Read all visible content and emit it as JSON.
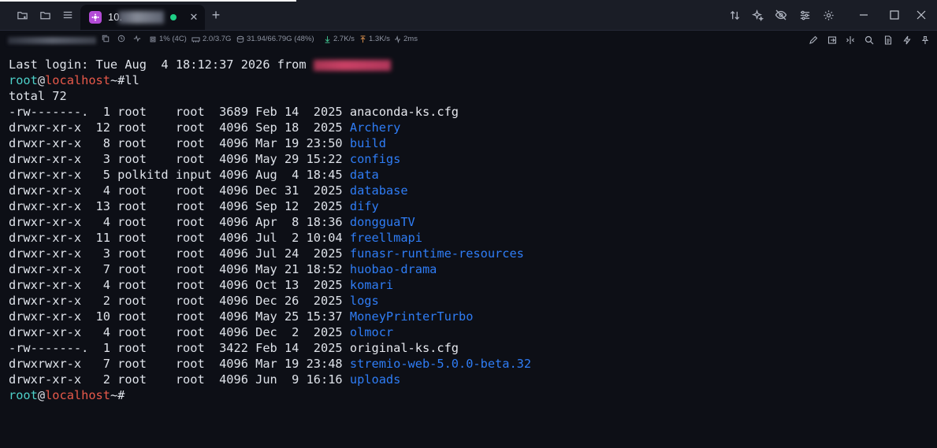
{
  "titlebar": {
    "left_icons": [
      "new-folder-icon",
      "folder-icon",
      "menu-icon"
    ],
    "tab": {
      "title": "10.",
      "icon": "server-icon",
      "status_color": "#1fcf86",
      "close_glyph": "✕"
    },
    "add_tab_glyph": "+",
    "right_icons": [
      "sort-icon",
      "sparkle-icon",
      "eye-off-icon",
      "sliders-icon",
      "settings-icon"
    ],
    "window_controls": {
      "minimize": "—",
      "maximize": "☐",
      "close": "✕"
    }
  },
  "statusbar": {
    "cpu": "1% (4C)",
    "memory": "2.0/3.7G",
    "disk": "31.94/66.79G (48%)",
    "download": "2.7K/s",
    "upload": "1.3K/s",
    "latency": "2ms",
    "tools": [
      "pen-icon",
      "import-icon",
      "split-icon",
      "search-icon",
      "document-icon",
      "bolt-icon",
      "pin-icon"
    ]
  },
  "terminal": {
    "login_line": "Last login: Tue Aug  4 18:12:37 2026 from ",
    "prompt": {
      "user": "root",
      "at": "@",
      "host": "localhost",
      "path": "~#"
    },
    "command": "ll",
    "total_line": "total 72",
    "entries": [
      {
        "meta": "-rw-------.  1 root    root  3689 Feb 14  2025 ",
        "name": "anaconda-ks.cfg",
        "type": "file"
      },
      {
        "meta": "drwxr-xr-x  12 root    root  4096 Sep 18  2025 ",
        "name": "Archery",
        "type": "dir"
      },
      {
        "meta": "drwxr-xr-x   8 root    root  4096 Mar 19 23:50 ",
        "name": "build",
        "type": "dir"
      },
      {
        "meta": "drwxr-xr-x   3 root    root  4096 May 29 15:22 ",
        "name": "configs",
        "type": "dir"
      },
      {
        "meta": "drwxr-xr-x   5 polkitd input 4096 Aug  4 18:45 ",
        "name": "data",
        "type": "dir"
      },
      {
        "meta": "drwxr-xr-x   4 root    root  4096 Dec 31  2025 ",
        "name": "database",
        "type": "dir"
      },
      {
        "meta": "drwxr-xr-x  13 root    root  4096 Sep 12  2025 ",
        "name": "dify",
        "type": "dir"
      },
      {
        "meta": "drwxr-xr-x   4 root    root  4096 Apr  8 18:36 ",
        "name": "dongguaTV",
        "type": "dir"
      },
      {
        "meta": "drwxr-xr-x  11 root    root  4096 Jul  2 10:04 ",
        "name": "freellmapi",
        "type": "dir"
      },
      {
        "meta": "drwxr-xr-x   3 root    root  4096 Jul 24  2025 ",
        "name": "funasr-runtime-resources",
        "type": "dir"
      },
      {
        "meta": "drwxr-xr-x   7 root    root  4096 May 21 18:52 ",
        "name": "huobao-drama",
        "type": "dir"
      },
      {
        "meta": "drwxr-xr-x   4 root    root  4096 Oct 13  2025 ",
        "name": "komari",
        "type": "dir"
      },
      {
        "meta": "drwxr-xr-x   2 root    root  4096 Dec 26  2025 ",
        "name": "logs",
        "type": "dir"
      },
      {
        "meta": "drwxr-xr-x  10 root    root  4096 May 25 15:37 ",
        "name": "MoneyPrinterTurbo",
        "type": "dir"
      },
      {
        "meta": "drwxr-xr-x   4 root    root  4096 Dec  2  2025 ",
        "name": "olmocr",
        "type": "dir"
      },
      {
        "meta": "-rw-------.  1 root    root  3422 Feb 14  2025 ",
        "name": "original-ks.cfg",
        "type": "file"
      },
      {
        "meta": "drwxrwxr-x   7 root    root  4096 Mar 19 23:48 ",
        "name": "stremio-web-5.0.0-beta.32",
        "type": "dir"
      },
      {
        "meta": "drwxr-xr-x   2 root    root  4096 Jun  9 16:16 ",
        "name": "uploads",
        "type": "dir"
      }
    ],
    "colors": {
      "user": "#4dd0c9",
      "host": "#e8594a",
      "directory": "#2f7df6",
      "text": "#dfe3ea"
    }
  }
}
